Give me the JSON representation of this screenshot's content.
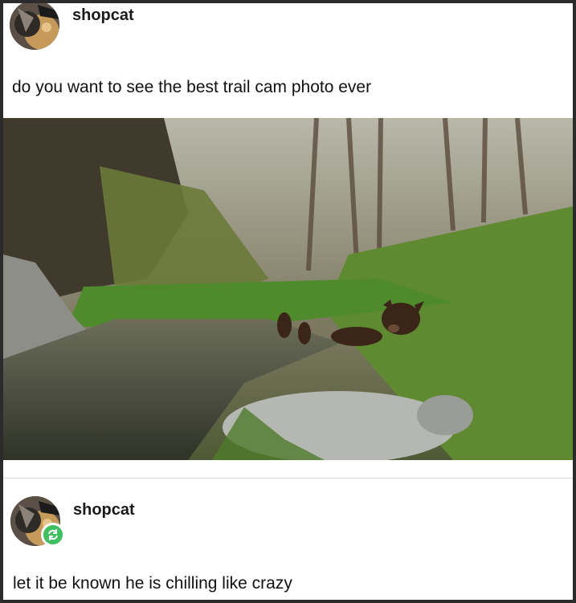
{
  "post": {
    "username": "shopcat",
    "text": "do you want to see the best trail cam photo ever"
  },
  "reply": {
    "username": "shopcat",
    "text": "let it be known he is chilling like crazy"
  },
  "icons": {
    "avatar": "cat-avatar-icon",
    "reblog": "reblog-icon"
  },
  "colors": {
    "reblog_badge": "#3fbf5f"
  }
}
